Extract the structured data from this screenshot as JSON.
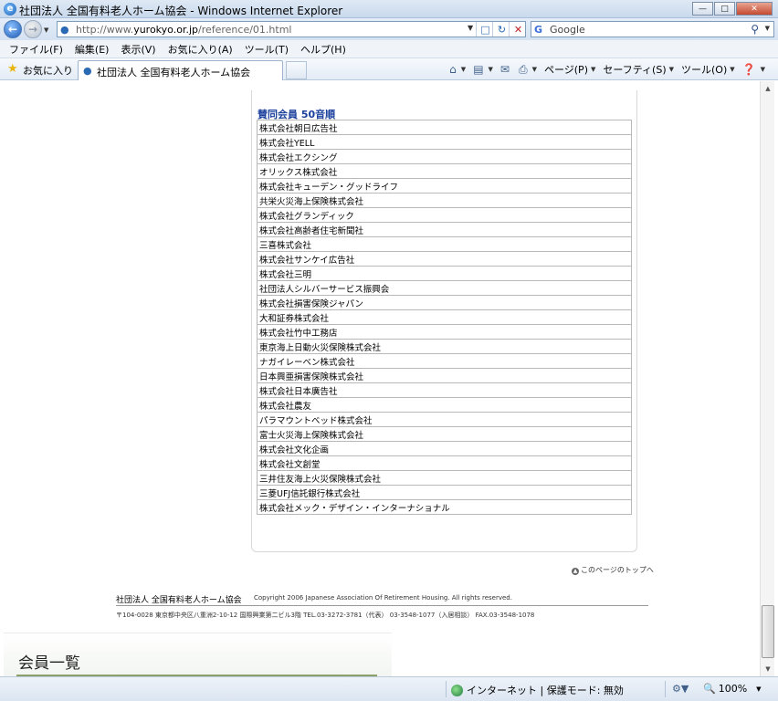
{
  "window": {
    "title": "社団法人 全国有料老人ホーム協会 - Windows Internet Explorer",
    "buttons": {
      "minimize": "—",
      "maximize": "□",
      "close": "✕"
    }
  },
  "address": {
    "url_prefix": "http://www.",
    "url_domain": "yurokyo.or.jp",
    "url_path": "/reference/01.html",
    "search_engine": "Google"
  },
  "menu": [
    "ファイル(F)",
    "編集(E)",
    "表示(V)",
    "お気に入り(A)",
    "ツール(T)",
    "ヘルプ(H)"
  ],
  "favorites": {
    "label": "お気に入り"
  },
  "tab": {
    "label": "社団法人 全国有料老人ホーム協会"
  },
  "command_bar": {
    "page": "ページ(P)",
    "safety": "セーフティ(S)",
    "tools": "ツール(O)"
  },
  "page": {
    "section_title": "賛同会員 50音順",
    "members": [
      "株式会社朝日広告社",
      "株式会社YELL",
      "株式会社エクシング",
      "オリックス株式会社",
      "株式会社キューデン・グッドライフ",
      "共栄火災海上保険株式会社",
      "株式会社グランディック",
      "株式会社高齢者住宅新聞社",
      "三喜株式会社",
      "株式会社サンケイ広告社",
      "株式会社三明",
      "社団法人シルバーサービス振興会",
      "株式会社損害保険ジャパン",
      "大和証券株式会社",
      "株式会社竹中工務店",
      "東京海上日動火災保険株式会社",
      "ナガイレーベン株式会社",
      "日本興亜損害保険株式会社",
      "株式会社日本廣告社",
      "株式会社農友",
      "パラマウントベッド株式会社",
      "富士火災海上保険株式会社",
      "株式会社文化企画",
      "株式会社文創堂",
      "三井住友海上火災保険株式会社",
      "三菱UFJ信託銀行株式会社",
      "株式会社メック・デザイン・インターナショナル"
    ],
    "page_top_link": "このページのトップへ",
    "footer": {
      "org": "社団法人 全国有料老人ホーム協会",
      "copyright": "Copyright 2006 Japanese Association Of Retirement Housing.  All rights reserved.",
      "address": "〒104-0028 東京都中央区八重洲2-10-12 国際興業第二ビル3階  TEL.03-3272-3781（代表） 03-3548-1077（入居相談）  FAX.03-3548-1078"
    },
    "member_list_heading": "会員一覧"
  },
  "status": {
    "zone": "インターネット | 保護モード: 無効",
    "zoom": "100%"
  }
}
